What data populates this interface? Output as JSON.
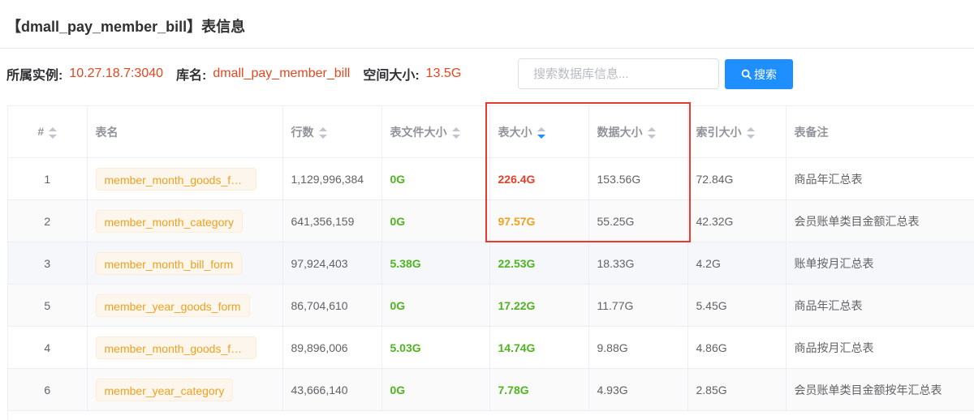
{
  "page": {
    "title": "【dmall_pay_member_bill】表信息"
  },
  "info": {
    "instance_label": "所属实例:",
    "instance_value": "10.27.18.7:3040",
    "db_label": "库名:",
    "db_value": "dmall_pay_member_bill",
    "space_label": "空间大小:",
    "space_value": "13.5G"
  },
  "search": {
    "placeholder": "搜索数据库信息...",
    "button_label": "搜索",
    "icon": "search-icon"
  },
  "colors": {
    "accent": "#1f8fff",
    "red": "#e2402b",
    "orange": "#f0a020",
    "green": "#4fb41f",
    "highlight": "#e53b30"
  },
  "table": {
    "sort": {
      "column": "table_size",
      "direction": "desc"
    },
    "headers": {
      "idx": "#",
      "name": "表名",
      "rows": "行数",
      "file_size": "表文件大小",
      "table_size": "表大小",
      "data_size": "数据大小",
      "index_size": "索引大小",
      "comment": "表备注"
    },
    "rows": [
      {
        "idx": "1",
        "name": "member_month_goods_for...",
        "rows": "1,129,996,384",
        "file_size": "0G",
        "table_size": "226.4G",
        "table_size_color": "red",
        "data_size": "153.56G",
        "index_size": "72.84G",
        "comment": "商品年汇总表"
      },
      {
        "idx": "2",
        "name": "member_month_category",
        "rows": "641,356,159",
        "file_size": "0G",
        "table_size": "97.57G",
        "table_size_color": "orange",
        "data_size": "55.25G",
        "index_size": "42.32G",
        "comment": "会员账单类目金额汇总表"
      },
      {
        "idx": "3",
        "name": "member_month_bill_form",
        "rows": "97,924,403",
        "file_size": "5.38G",
        "table_size": "22.53G",
        "table_size_color": "green",
        "data_size": "18.33G",
        "index_size": "4.2G",
        "comment": "账单按月汇总表"
      },
      {
        "idx": "5",
        "name": "member_year_goods_form",
        "rows": "86,704,610",
        "file_size": "0G",
        "table_size": "17.22G",
        "table_size_color": "green",
        "data_size": "11.77G",
        "index_size": "5.45G",
        "comment": "商品年汇总表"
      },
      {
        "idx": "4",
        "name": "member_month_goods_form",
        "rows": "89,896,006",
        "file_size": "5.03G",
        "table_size": "14.74G",
        "table_size_color": "green",
        "data_size": "9.88G",
        "index_size": "4.86G",
        "comment": "商品按月汇总表"
      },
      {
        "idx": "6",
        "name": "member_year_category",
        "rows": "43,666,140",
        "file_size": "0G",
        "table_size": "7.78G",
        "table_size_color": "green",
        "data_size": "4.93G",
        "index_size": "2.85G",
        "comment": "会员账单类目金额按年汇总表"
      }
    ]
  }
}
